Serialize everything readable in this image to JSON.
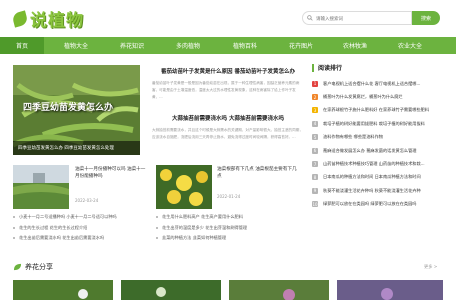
{
  "header": {
    "logo_text": "说植物",
    "search_placeholder": "请输入搜索词",
    "search_button": "搜索"
  },
  "nav": [
    "首页",
    "植物大全",
    "养花知识",
    "多肉植物",
    "植物百科",
    "花卉图片",
    "农林牧渔",
    "农业大全"
  ],
  "featured": {
    "overlay_text": "四季豆幼苗发黄怎么办",
    "caption": "四季豆幼苗发黄怎么办 四季豆幼苗发黄怎么处理"
  },
  "articles": [
    {
      "title": "番茄幼苗叶子发黄是什么原因 番茄幼苗叶子发黄怎么办",
      "body": "番茄幼苗叶子发黄是一般是因为番茄幼苗在出现，属于一种生理性病害，因缺乏营养元素的病害，可能是由于土壤温度低，温度太大过的水理性发黄现象，这种在病害除了给上作叶子发黄，..."
    },
    {
      "title": "大蒜抽苔前需要浇水吗 大蒜抽苔前需要浇水吗",
      "body": "大蒜抽苔前需要浇水，并且这个时候是大蒜需水的关键期，对产量影响很大。抽苔主茎的同期，应该浇水自施肥，浇肥后浇用三天再停止施水，避免浇得过度时间较间隔，获得高苔好。..."
    }
  ],
  "cards": [
    {
      "title": "油菜十一月份播种可以吗 油菜十一月份能播种吗",
      "date": "2022-03-24"
    },
    {
      "title": "油菜根部有下几点 油菜根茄主要有下几点",
      "date": "2022-01-24"
    }
  ],
  "links_left": [
    "小麦十一月二号适播种吗 小麦十一月二号适可以种吗",
    "花生的生长过程 花生的生长过程介绍",
    "花生出苗后需要浇水吗 花生出苗后需要浇水吗"
  ],
  "links_right": [
    "花生用什么肥料高产 花生高产要用什么肥料",
    "花生出芽的温度是多少 花生出芽温和刷得管理",
    "韭菜的种植方法 韭菜如何种植管理"
  ],
  "sidebar": {
    "title": "阅读排行",
    "items": [
      {
        "num": "1",
        "text": "客户电视机上适合摆什么花 客厅电视机上适合摆哪..."
      },
      {
        "num": "2",
        "text": "桶葱叶为什么发黄腐烂，桶葱叶为什么腐烂"
      },
      {
        "num": "3",
        "text": "在家养球根竹子施什么肥料好 在家养球竹子需要哪些肥料"
      },
      {
        "num": "4",
        "text": "栽培子植的树好能要用拔肥料 栽培子植的树好能用拔料"
      },
      {
        "num": "5",
        "text": "油料作物有哪些 哪些是油料作物"
      },
      {
        "num": "6",
        "text": "蓖麻适合做发展怎么办 蓖麻发菌的话发黄怎么管理"
      },
      {
        "num": "7",
        "text": "山药苗种植技术种植技巧管理 山药苗的种植技术和栽..."
      },
      {
        "num": "8",
        "text": "日本南瓜的种植方法和时间 日本南瓜种植方法和时间"
      },
      {
        "num": "9",
        "text": "秋葵不能浇灌生活花卉种吗 秋葵不能浇灌生活花卉种"
      },
      {
        "num": "10",
        "text": "绿萝肥可以放在在类园吗 绿萝肥可以放在在类园吗"
      }
    ]
  },
  "share": {
    "title": "养花分享",
    "more": "更多 >"
  },
  "colors": {
    "brand_green": "#6cb33f",
    "nav_active": "#4f9a2a"
  }
}
